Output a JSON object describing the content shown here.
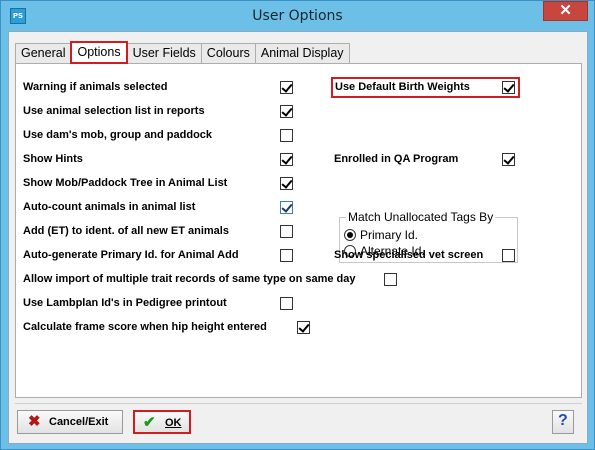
{
  "window": {
    "title": "User Options",
    "app_icon": "PS",
    "close_glyph": "✕"
  },
  "tabs": [
    {
      "label": "General",
      "active": false
    },
    {
      "label": "Options",
      "active": true
    },
    {
      "label": "User Fields",
      "active": false
    },
    {
      "label": "Colours",
      "active": false
    },
    {
      "label": "Animal Display",
      "active": false
    }
  ],
  "options_left": [
    {
      "label": "Warning if animals selected",
      "checked": true
    },
    {
      "label": "Use animal selection list in reports",
      "checked": true
    },
    {
      "label": "Use dam's mob, group and paddock",
      "checked": false
    },
    {
      "label": "Show Hints",
      "checked": true
    },
    {
      "label": "Show Mob/Paddock Tree in Animal List",
      "checked": true
    },
    {
      "label": "Auto-count animals in animal list",
      "checked": true
    },
    {
      "label": "Add (ET) to ident. of all new ET animals",
      "checked": false
    },
    {
      "label": "Auto-generate Primary Id. for Animal Add",
      "checked": false
    },
    {
      "label": "Allow import of multiple trait records of same type on same day",
      "checked": false
    },
    {
      "label": "Use Lambplan Id's in Pedigree printout",
      "checked": false
    },
    {
      "label": "Calculate frame score when hip height entered",
      "checked": true
    }
  ],
  "options_right": [
    {
      "label": "Use Default Birth Weights",
      "checked": true
    },
    {
      "label": "Enrolled in QA Program",
      "checked": true
    },
    {
      "label": "Show specialised vet screen",
      "checked": false
    }
  ],
  "match_group": {
    "legend": "Match Unallocated Tags By",
    "options": [
      {
        "label": "Primary Id.",
        "selected": true
      },
      {
        "label": "Alternate Id.",
        "selected": false
      }
    ]
  },
  "footer": {
    "cancel_label": "Cancel/Exit",
    "cancel_icon": "✖",
    "ok_label": "OK",
    "ok_icon": "✔",
    "help_icon": "?"
  },
  "colors": {
    "highlight": "#d11d1d",
    "titlebar": "#6cc0e8"
  }
}
